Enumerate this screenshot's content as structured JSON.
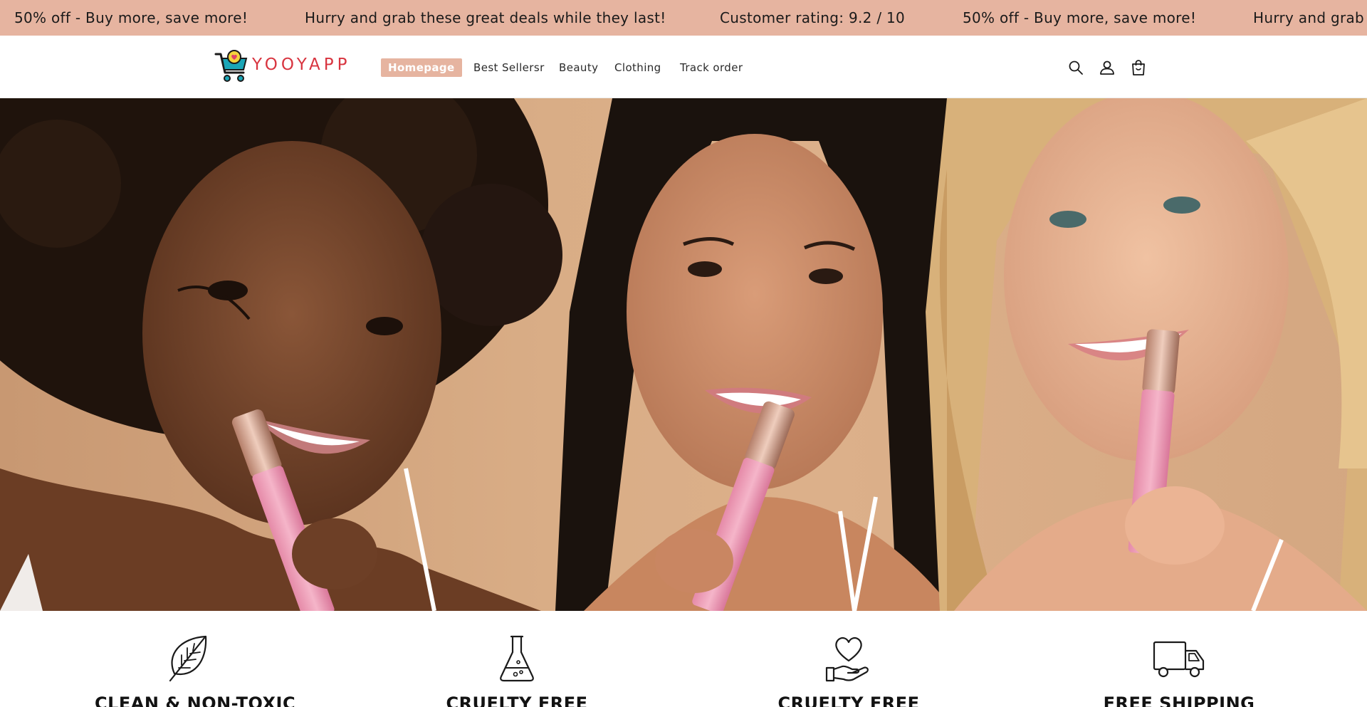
{
  "announcement": {
    "items": [
      "50% off - Buy more, save more!",
      "Hurry and grab these great deals while they last!",
      "Customer rating: 9.2 / 10",
      "50% off - Buy more, save more!",
      "Hurry and grab these great deals while they last!"
    ]
  },
  "header": {
    "logo_text": "YOOYAPP",
    "nav": [
      "Homepage",
      "Best Sellersr",
      "Beauty",
      "Clothing",
      "Track order"
    ],
    "active_nav": "Homepage"
  },
  "hero": {
    "image_alt": "three-women-holding-pink-lip-gloss"
  },
  "features": [
    {
      "icon": "leaf-icon",
      "title": "CLEAN & NON-TOXIC"
    },
    {
      "icon": "flask-icon",
      "title": "CRUELTY FREE"
    },
    {
      "icon": "heart-hand-icon",
      "title": "CRUELTY FREE"
    },
    {
      "icon": "truck-icon",
      "title": "FREE SHIPPING"
    }
  ],
  "colors": {
    "announcement_bg": "#e6b4a0",
    "logo_red": "#d8343f",
    "logo_teal": "#1aa6b7"
  }
}
